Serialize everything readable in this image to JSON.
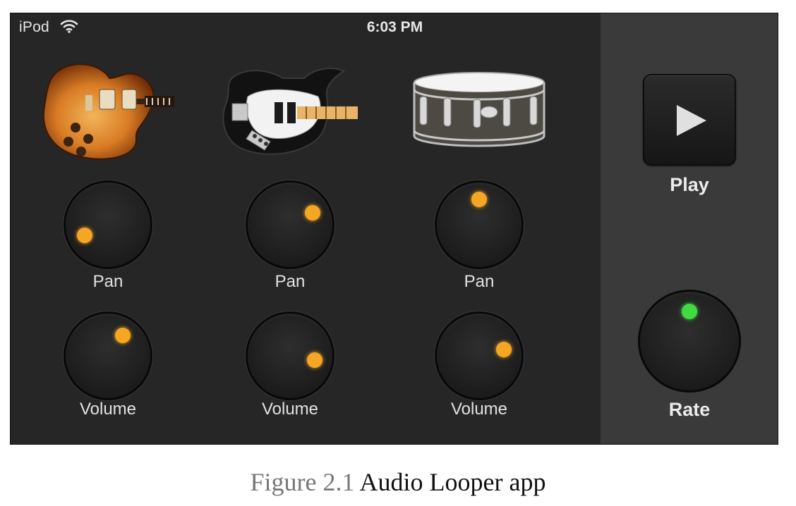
{
  "status_bar": {
    "carrier": "iPod",
    "time": "6:03 PM"
  },
  "colors": {
    "background": "#262626",
    "side_panel": "#3a3a3a",
    "knob_indicator": "#f5a623",
    "rate_indicator": "#3fdc3f",
    "battery": "#3fdc3f"
  },
  "instruments": [
    {
      "icon": "electric-guitar-icon",
      "pan": {
        "label": "Pan",
        "angle_deg": 245
      },
      "volume": {
        "label": "Volume",
        "angle_deg": 35
      }
    },
    {
      "icon": "bass-guitar-icon",
      "pan": {
        "label": "Pan",
        "angle_deg": 62
      },
      "volume": {
        "label": "Volume",
        "angle_deg": 100
      }
    },
    {
      "icon": "snare-drum-icon",
      "pan": {
        "label": "Pan",
        "angle_deg": 0
      },
      "volume": {
        "label": "Volume",
        "angle_deg": 75
      }
    }
  ],
  "play": {
    "label": "Play",
    "icon": "play-icon"
  },
  "rate": {
    "label": "Rate",
    "angle_deg": 0
  },
  "caption": {
    "number": "Figure 2.1",
    "text": "Audio Looper app"
  }
}
